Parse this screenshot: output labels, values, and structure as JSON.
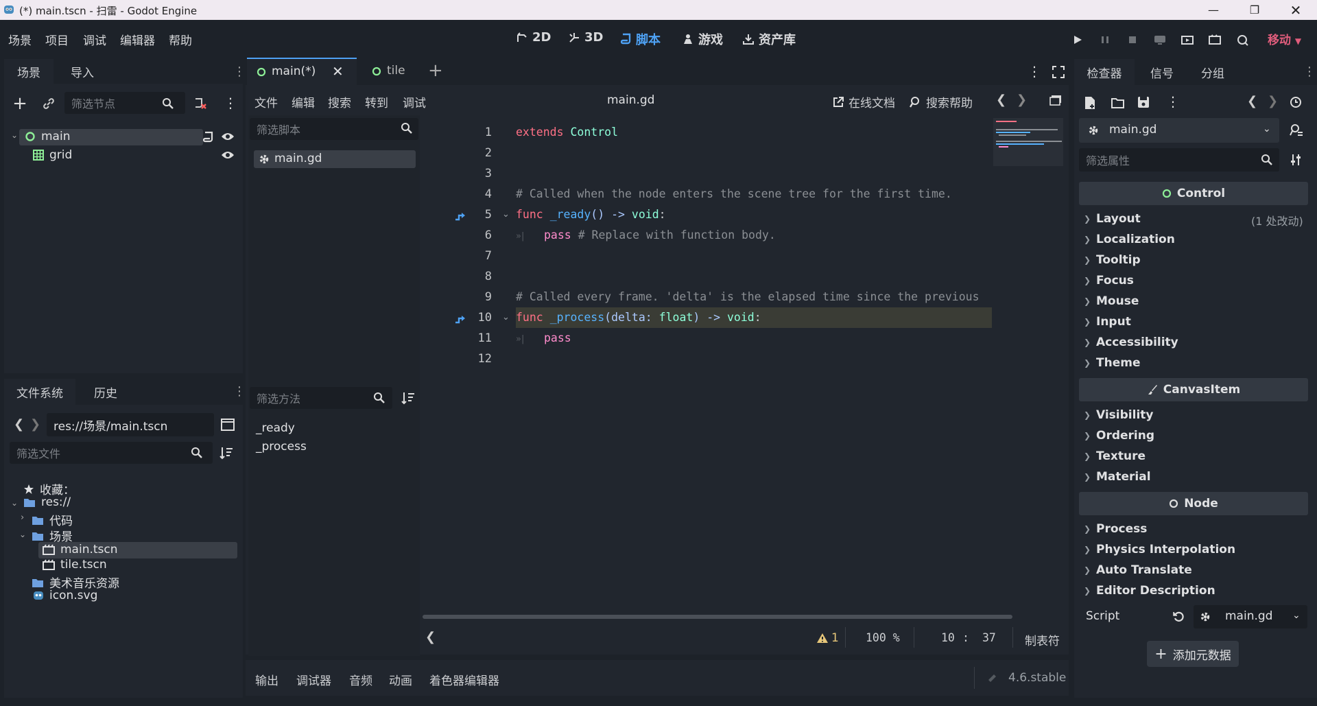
{
  "window": {
    "title": "(*) main.tscn - 扫雷 - Godot Engine"
  },
  "menu": [
    "场景",
    "项目",
    "调试",
    "编辑器",
    "帮助"
  ],
  "workspaces": [
    {
      "label": "2D",
      "icon": "2d-icon"
    },
    {
      "label": "3D",
      "icon": "3d-icon"
    },
    {
      "label": "脚本",
      "icon": "script-icon",
      "active": true
    },
    {
      "label": "游戏",
      "icon": "game-icon"
    },
    {
      "label": "资产库",
      "icon": "assetlib-icon"
    }
  ],
  "renderer": "移动",
  "scene_dock": {
    "tabs": [
      "场景",
      "导入"
    ],
    "filter_placeholder": "筛选节点",
    "nodes": [
      {
        "name": "main"
      },
      {
        "name": "grid"
      }
    ]
  },
  "filesystem_dock": {
    "tabs": [
      "文件系统",
      "历史"
    ],
    "path": "res://场景/main.tscn",
    "filter_placeholder": "筛选文件",
    "items": {
      "favorites": "收藏：",
      "res": "res://",
      "code": "代码",
      "scenes": "场景",
      "main": "main.tscn",
      "tile": "tile.tscn",
      "art": "美术音乐资源",
      "icon": "icon.svg"
    }
  },
  "editor": {
    "tabs": [
      "main(*)",
      "tile"
    ],
    "script_menu": [
      "文件",
      "编辑",
      "搜索",
      "转到",
      "调试"
    ],
    "script_name": "main.gd",
    "online_docs": "在线文档",
    "search_help": "搜索帮助",
    "script_filter_placeholder": "筛选脚本",
    "scripts": [
      "main.gd"
    ],
    "method_filter_placeholder": "筛选方法",
    "methods": [
      "_ready",
      "_process"
    ],
    "line_numbers": [
      "1",
      "2",
      "3",
      "4",
      "5",
      "6",
      "7",
      "8",
      "9",
      "10",
      "11",
      "12"
    ],
    "code": {
      "l1_kw": "extends",
      "l1_ty": "Control",
      "l4": "# Called when the node enters the scene tree for the first time.",
      "l5_kw": "func",
      "l5_fn": "_ready",
      "l5_rest": "() -> ",
      "l5_ty": "void",
      "l5_end": ":",
      "l6_kw": "pass",
      "l6_cm": "# Replace with function body.",
      "l9": "# Called every frame. 'delta' is the elapsed time since the previous",
      "l10_kw": "func",
      "l10_fn": "_process",
      "l10_a": "(delta: ",
      "l10_ty": "float",
      "l10_b": ") -> ",
      "l10_ty2": "void",
      "l10_end": ":",
      "l11_kw": "pass"
    },
    "status": {
      "warnings": "1",
      "zoom": "100 %",
      "line": "10",
      "sep": ":",
      "col": "37",
      "indent": "制表符"
    }
  },
  "bottom_panel": {
    "tabs": [
      "输出",
      "调试器",
      "音频",
      "动画",
      "着色器编辑器"
    ],
    "version": "4.6.stable"
  },
  "inspector": {
    "tabs": [
      "检查器",
      "信号",
      "分组"
    ],
    "resource": "main.gd",
    "filter_placeholder": "筛选属性",
    "control_header": "Control",
    "control_props": [
      "Layout",
      "Localization",
      "Tooltip",
      "Focus",
      "Mouse",
      "Input",
      "Accessibility",
      "Theme"
    ],
    "layout_changes": "(1 处改动)",
    "canvasitem_header": "CanvasItem",
    "canvasitem_props": [
      "Visibility",
      "Ordering",
      "Texture",
      "Material"
    ],
    "node_header": "Node",
    "node_props": [
      "Process",
      "Physics Interpolation",
      "Auto Translate",
      "Editor Description"
    ],
    "script_label": "Script",
    "script_value": "main.gd",
    "add_metadata": "添加元数据"
  }
}
